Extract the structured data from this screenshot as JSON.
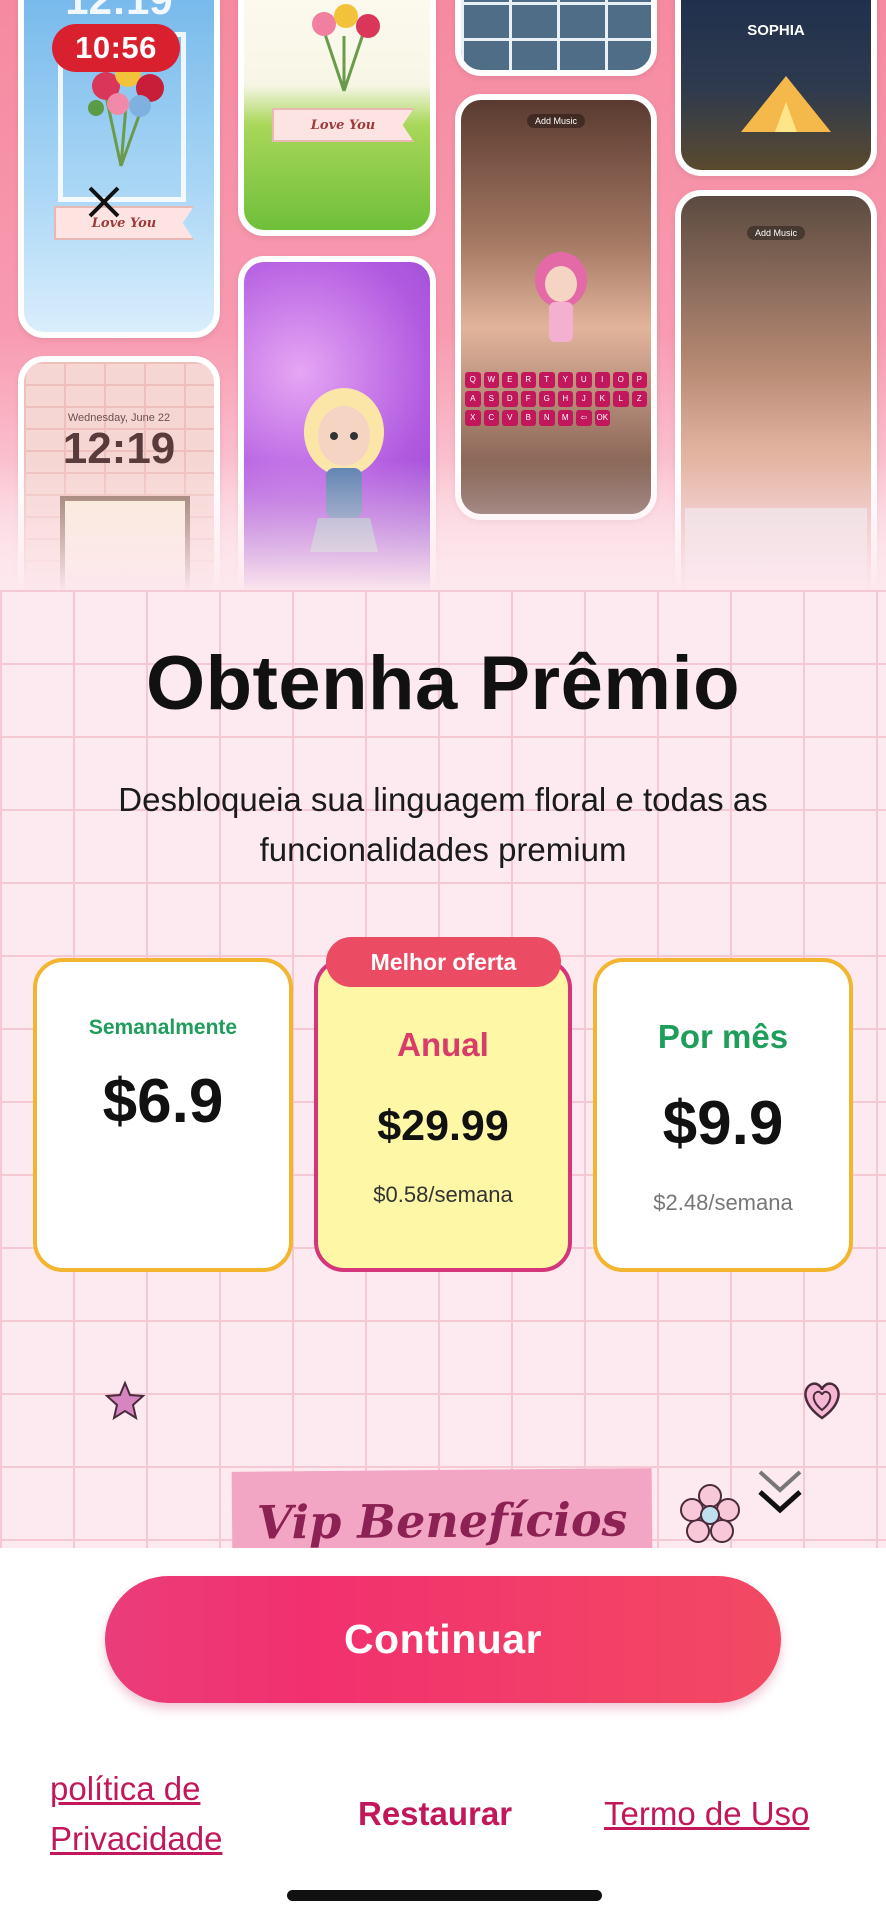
{
  "status_bar": {
    "time": "10:56"
  },
  "hero": {
    "lock_time": "12:19",
    "lock_date": "Wednesday, June 22",
    "ribbon_text": "Love You",
    "camp_name": "SOPHIA",
    "add_music": "Add Music",
    "keyboard_rows": [
      [
        "Q",
        "W",
        "E",
        "R",
        "T",
        "Y",
        "U",
        "I",
        "O",
        "P"
      ],
      [
        "A",
        "S",
        "D",
        "F",
        "G",
        "H",
        "J",
        "K",
        "L"
      ],
      [
        "Z",
        "X",
        "C",
        "V",
        "B",
        "N",
        "M",
        "⇦",
        "OK"
      ]
    ]
  },
  "title": "Obtenha Prêmio",
  "subtitle": "Desbloqueia sua linguagem floral e todas as funcionalidades premium",
  "plans": [
    {
      "name": "Semanalmente",
      "price": "$6.9",
      "sub": ""
    },
    {
      "name": "Anual",
      "price": "$29.99",
      "sub": "$0.58/semana",
      "badge": "Melhor oferta"
    },
    {
      "name": "Por mês",
      "price": "$9.9",
      "sub": "$2.48/semana"
    }
  ],
  "vip_banner": "Vip Benefícios",
  "continue_label": "Continuar",
  "footer": {
    "privacy": "política de Privacidade",
    "restore": "Restaurar",
    "terms": "Termo de Uso"
  },
  "colors": {
    "accent": "#ec4c63",
    "plan_border": "#f2b52f",
    "annual_border": "#d4357b",
    "annual_fill": "#fdf7a6",
    "green": "#1e9e5a",
    "pink_text": "#c2185b"
  }
}
